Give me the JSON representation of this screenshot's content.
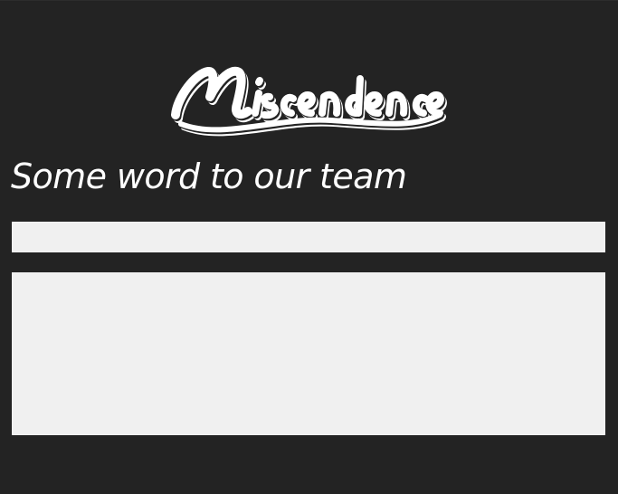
{
  "brand": {
    "logo_text": "Miscendence"
  },
  "form": {
    "heading": "Some word to our team",
    "name_field": {
      "value": "",
      "placeholder": ""
    },
    "message_field": {
      "value": "",
      "placeholder": ""
    }
  },
  "colors": {
    "background": "#232323",
    "field_background": "#f0f0f0",
    "text": "#ffffff"
  }
}
